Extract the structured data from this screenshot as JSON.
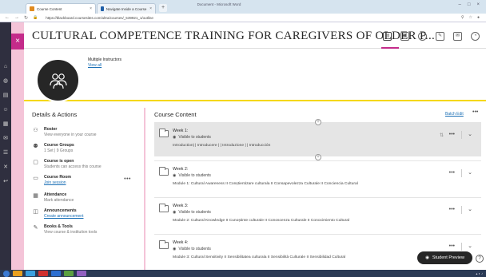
{
  "browser": {
    "tabs": [
      {
        "label": "Course Content",
        "active": true,
        "color": "#e08a1e"
      },
      {
        "label": "Navigate Inside a Course | Blackboard...",
        "active": false,
        "color": "#1f5fa8"
      }
    ],
    "window_title": "Document - Microsoft Word",
    "url": "https://blackboard.coursesites.com/ultra/courses/_539921_1/outline"
  },
  "course": {
    "title": "CULTURAL COMPETENCE TRAINING FOR CAREGIVERS OF OLDER P...",
    "header_icons": [
      "outline-icon",
      "calendar-icon",
      "discussion-icon",
      "gradebook-icon",
      "messages-icon",
      "analytics-icon"
    ],
    "instructors_label": "Multiple Instructors",
    "view_all": "View all"
  },
  "details": {
    "title": "Details & Actions",
    "items": [
      {
        "title": "Roster",
        "sub": "View everyone in your course",
        "link": "",
        "icon": "roster-icon"
      },
      {
        "title": "Course Groups",
        "sub": "1 Set | 9 Groups",
        "link": "",
        "icon": "groups-icon"
      },
      {
        "title": "Course is open",
        "sub": "Students can access this course",
        "link": "",
        "icon": "open-icon"
      },
      {
        "title": "Course Room",
        "sub": "",
        "link": "Join session",
        "icon": "room-icon"
      },
      {
        "title": "Attendance",
        "sub": "Mark attendance",
        "link": "",
        "icon": "attendance-icon"
      },
      {
        "title": "Announcements",
        "sub": "",
        "link": "Create announcement",
        "icon": "announcements-icon"
      },
      {
        "title": "Books & Tools",
        "sub": "View course & institution tools",
        "link": "",
        "icon": "tools-icon"
      }
    ],
    "more": "•••"
  },
  "content": {
    "title": "Course Content",
    "batch_edit": "Batch Edit",
    "more": "•••",
    "weeks": [
      {
        "title": "Week 1:",
        "visibility": "Visible to students",
        "desc": "Introduction| | Introducere | | Introduzione | | Introducción",
        "highlighted": true
      },
      {
        "title": "Week 2:",
        "visibility": "Visible to students",
        "desc": "Module 1: Cultural Awareness II Conștientizare culturala II Consapevolezza Culturale II Conciencia Cultural",
        "highlighted": false
      },
      {
        "title": "Week 3:",
        "visibility": "Visible to students",
        "desc": "Module 2: Cultural Knowledge II Cunoștinte culturale II Conoscenza Culturale II Conocimiento Cultural",
        "highlighted": false
      },
      {
        "title": "Week 4:",
        "visibility": "Visible to students",
        "desc": "Module 3: Cultural Sensitivity II Sensibilitatea culturala II Sensibilità Culturale II Sensibilidad Cultural",
        "highlighted": false
      }
    ]
  },
  "student_preview": "Student Preview",
  "help": "?",
  "colors": {
    "accent": "#c42b8a",
    "banner_line": "#f5d80a",
    "link": "#1a6fb5",
    "rail": "#2f2f3f"
  }
}
